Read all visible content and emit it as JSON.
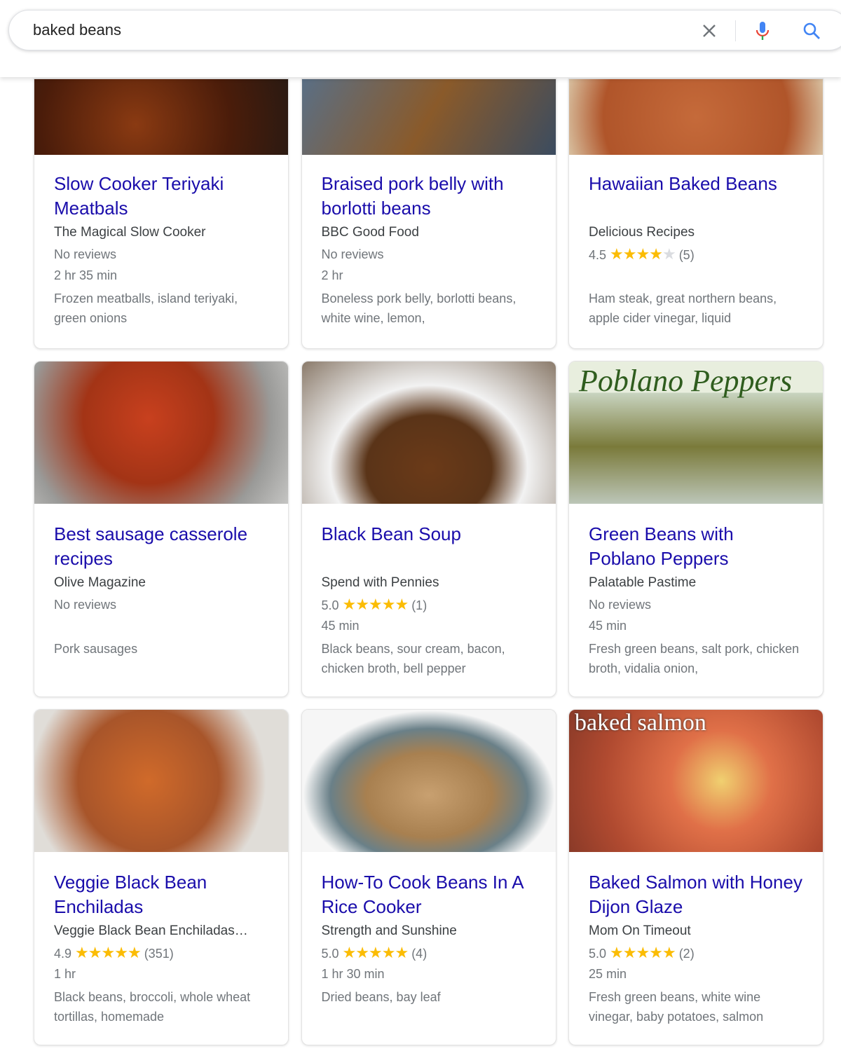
{
  "search": {
    "query": "baked beans",
    "clear_icon": "close-icon",
    "mic_icon": "microphone-icon",
    "search_icon": "search-icon"
  },
  "colors": {
    "title": "#1a0dab",
    "star": "#fbbc04"
  },
  "recipes": [
    {
      "title": "Slow Cooker Teriyaki Meatbals",
      "source": "The Magical Slow Cooker",
      "rating": "",
      "stars": 0,
      "reviews": "No reviews",
      "time": "2 hr 35 min",
      "ingredients": "Frozen meatballs, island teriyaki, green onions"
    },
    {
      "title": "Braised pork belly with borlotti beans",
      "source": "BBC Good Food",
      "rating": "",
      "stars": 0,
      "reviews": "No reviews",
      "time": "2 hr",
      "ingredients": "Boneless pork belly, borlotti beans, white wine, lemon,"
    },
    {
      "title": "Hawaiian Baked Beans",
      "source": "Delicious Recipes",
      "rating": "4.5",
      "stars": 4.5,
      "reviews": "(5)",
      "time": "",
      "ingredients": "Ham steak, great northern beans, apple cider vinegar, liquid"
    },
    {
      "title": "Best sausage casserole recipes",
      "source": "Olive Magazine",
      "rating": "",
      "stars": 0,
      "reviews": "No reviews",
      "time": "",
      "ingredients": "Pork sausages"
    },
    {
      "title": "Black Bean Soup",
      "source": "Spend with Pennies",
      "rating": "5.0",
      "stars": 5,
      "reviews": "(1)",
      "time": "45 min",
      "ingredients": "Black beans, sour cream, bacon, chicken broth, bell pepper"
    },
    {
      "title": "Green Beans with Poblano Peppers",
      "source": "Palatable Pastime",
      "rating": "",
      "stars": 0,
      "reviews": "No reviews",
      "time": "45 min",
      "ingredients": "Fresh green beans, salt pork, chicken broth, vidalia onion,",
      "image_text": "Poblano Peppers"
    },
    {
      "title": "Veggie Black Bean Enchiladas",
      "source": "Veggie Black Bean Enchiladas…",
      "rating": "4.9",
      "stars": 5,
      "reviews": "(351)",
      "time": "1 hr",
      "ingredients": "Black beans, broccoli, whole wheat tortillas, homemade"
    },
    {
      "title": "How-To Cook Beans In A Rice Cooker",
      "source": "Strength and Sunshine",
      "rating": "5.0",
      "stars": 5,
      "reviews": "(4)",
      "time": "1 hr 30 min",
      "ingredients": "Dried beans, bay leaf"
    },
    {
      "title": "Baked Salmon with Honey Dijon Glaze",
      "source": "Mom On Timeout",
      "rating": "5.0",
      "stars": 5,
      "reviews": "(2)",
      "time": "25 min",
      "ingredients": "Fresh green beans, white wine vinegar, baby potatoes, salmon",
      "image_text": "baked salmon"
    }
  ]
}
